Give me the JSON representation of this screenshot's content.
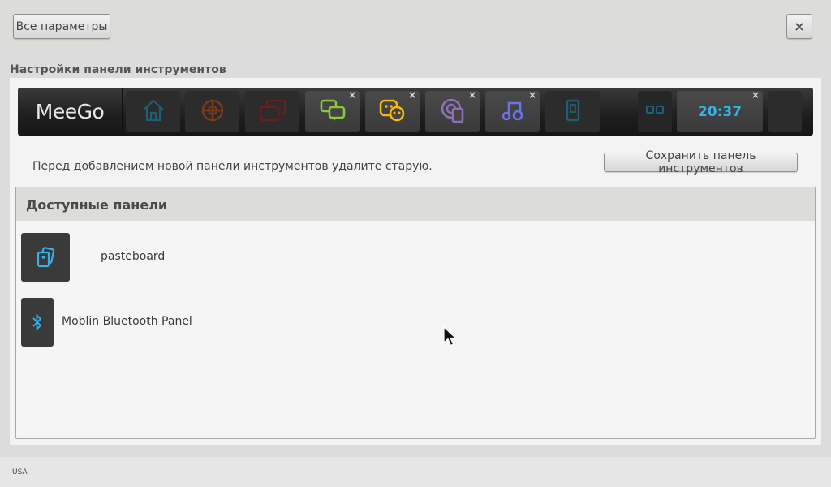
{
  "topbar": {
    "all_params_label": "Все параметры",
    "close_label": "×"
  },
  "section_title": "Настройки панели инструментов",
  "toolbar": {
    "logo": "MeeGo",
    "slots": [
      {
        "icon": "home-icon",
        "active": false,
        "removable": false
      },
      {
        "icon": "zones-icon",
        "active": false,
        "removable": false
      },
      {
        "icon": "applications-icon",
        "active": false,
        "removable": false
      },
      {
        "icon": "people-icon",
        "active": true,
        "removable": true
      },
      {
        "icon": "status-icon",
        "active": true,
        "removable": true
      },
      {
        "icon": "internet-icon",
        "active": true,
        "removable": true
      },
      {
        "icon": "music-icon",
        "active": true,
        "removable": true
      },
      {
        "icon": "devices-icon",
        "active": false,
        "removable": false
      }
    ],
    "remove_label": "×",
    "clock": "20:37"
  },
  "hint": "Перед добавлением новой панели инструментов удалите старую.",
  "save_label": "Сохранить панель инструментов",
  "available": {
    "title": "Доступные панели",
    "items": [
      {
        "label": "pasteboard",
        "icon": "pasteboard-icon"
      },
      {
        "label": "Moblin Bluetooth Panel",
        "icon": "bluetooth-icon"
      }
    ]
  },
  "status": {
    "locale": "USA"
  },
  "colors": {
    "accent": "#35b3e6",
    "toolbar_bg": "#1e1e1e",
    "people": "#8cc63f",
    "status": "#f6b90f",
    "internet": "#8e6fb8",
    "music": "#6b74e6"
  }
}
